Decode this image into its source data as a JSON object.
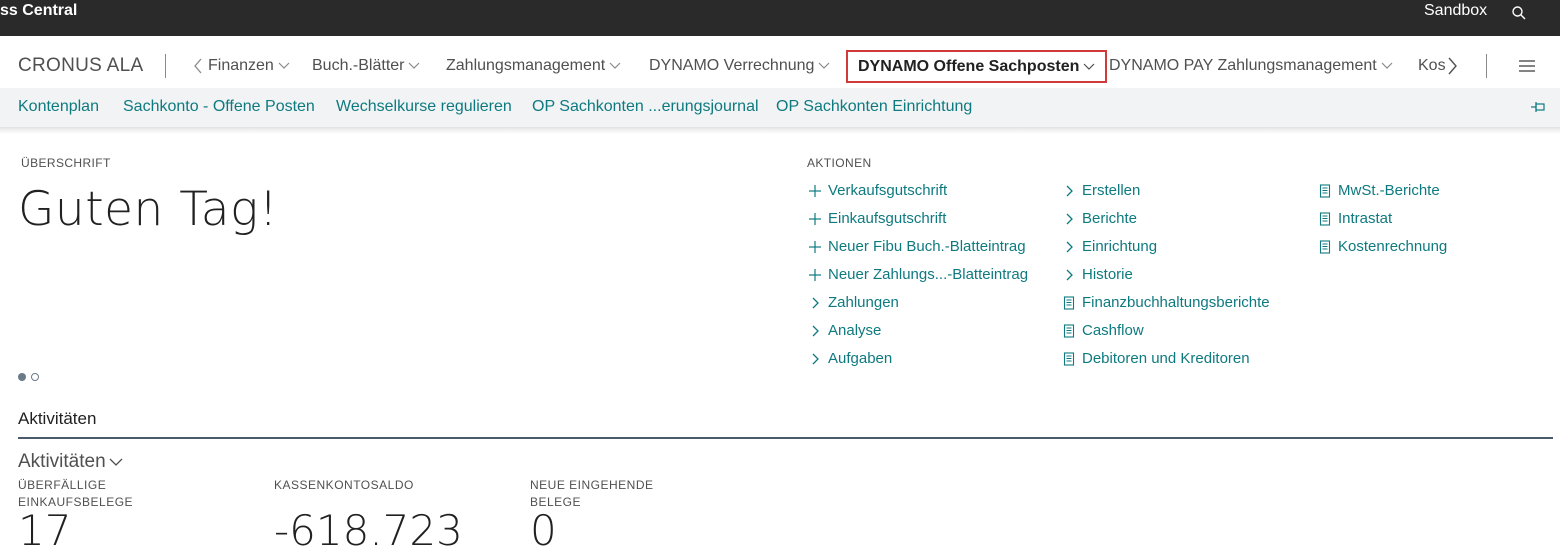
{
  "topbar": {
    "app_title": "ss Central",
    "environment": "Sandbox",
    "search_icon": "search-icon"
  },
  "navbar": {
    "company": "CRONUS ALA",
    "items": [
      {
        "label": "Finanzen"
      },
      {
        "label": "Buch.-Blätter"
      },
      {
        "label": "Zahlungsmanagement"
      },
      {
        "label": "DYNAMO Verrechnung"
      },
      {
        "label": "DYNAMO Offene Sachposten",
        "active": true
      },
      {
        "label": "DYNAMO PAY Zahlungsmanagement"
      },
      {
        "label": "Kos"
      }
    ],
    "active_border_color": "#d03a3a"
  },
  "subnav": {
    "links": [
      {
        "label": "Kontenplan"
      },
      {
        "label": "Sachkonto - Offene Posten"
      },
      {
        "label": "Wechselkurse regulieren"
      },
      {
        "label": "OP Sachkonten ...erungsjournal"
      },
      {
        "label": "OP Sachkonten Einrichtung"
      }
    ],
    "link_color": "#0e7a80"
  },
  "headline": {
    "caption": "ÜBERSCHRIFT",
    "greeting": "Guten Tag!",
    "pager_total": 2,
    "pager_current": 1
  },
  "actions": {
    "caption": "AKTIONEN",
    "col1": [
      {
        "label": "Verkaufsgutschrift",
        "icon": "plus-icon"
      },
      {
        "label": "Einkaufsgutschrift",
        "icon": "plus-icon"
      },
      {
        "label": "Neuer Fibu Buch.-Blatteintrag",
        "icon": "plus-icon"
      },
      {
        "label": "Neuer Zahlungs...-Blatteintrag",
        "icon": "plus-icon"
      },
      {
        "label": "Zahlungen",
        "icon": "chevron-right-icon"
      },
      {
        "label": "Analyse",
        "icon": "chevron-right-icon"
      },
      {
        "label": "Aufgaben",
        "icon": "chevron-right-icon"
      }
    ],
    "col2": [
      {
        "label": "Erstellen",
        "icon": "chevron-right-icon"
      },
      {
        "label": "Berichte",
        "icon": "chevron-right-icon"
      },
      {
        "label": "Einrichtung",
        "icon": "chevron-right-icon"
      },
      {
        "label": "Historie",
        "icon": "chevron-right-icon"
      },
      {
        "label": "Finanzbuchhaltungsberichte",
        "icon": "report-icon"
      },
      {
        "label": "Cashflow",
        "icon": "report-icon"
      },
      {
        "label": "Debitoren und Kreditoren",
        "icon": "report-icon"
      }
    ],
    "col3": [
      {
        "label": "MwSt.-Berichte",
        "icon": "report-icon"
      },
      {
        "label": "Intrastat",
        "icon": "report-icon"
      },
      {
        "label": "Kostenrechnung",
        "icon": "report-icon"
      }
    ]
  },
  "activities": {
    "section_title": "Aktivitäten",
    "group_title": "Aktivitäten",
    "tiles": [
      {
        "label": "ÜBERFÄLLIGE EINKAUFSBELEGE",
        "value": "17"
      },
      {
        "label": "KASSENKONTOSALDO",
        "value": "-618.723"
      },
      {
        "label": "NEUE EINGEHENDE BELEGE",
        "value": "0"
      }
    ]
  }
}
